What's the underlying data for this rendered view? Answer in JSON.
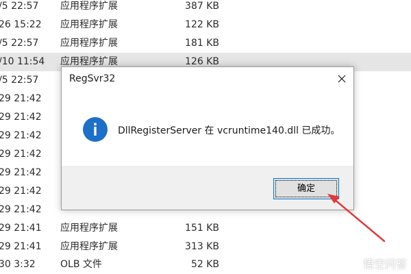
{
  "file_list": {
    "rows": [
      {
        "date": "/5 22:57",
        "type": "应用程序扩展",
        "size": "387 KB",
        "selected": false
      },
      {
        "date": "26 15:22",
        "type": "应用程序扩展",
        "size": "122 KB",
        "selected": false
      },
      {
        "date": "/5 22:57",
        "type": "应用程序扩展",
        "size": "181 KB",
        "selected": false
      },
      {
        "date": "/10 11:54",
        "type": "应用程序扩展",
        "size": "126 KB",
        "selected": true
      },
      {
        "date": "/5 22:57",
        "type": "",
        "size": "",
        "selected": false
      },
      {
        "date": "29 21:42",
        "type": "",
        "size": "",
        "selected": false
      },
      {
        "date": "29 21:42",
        "type": "",
        "size": "",
        "selected": false
      },
      {
        "date": "29 21:42",
        "type": "",
        "size": "",
        "selected": false
      },
      {
        "date": "29 21:42",
        "type": "",
        "size": "",
        "selected": false
      },
      {
        "date": "29 21:42",
        "type": "",
        "size": "",
        "selected": false
      },
      {
        "date": "29 21:42",
        "type": "",
        "size": "",
        "selected": false
      },
      {
        "date": "29 21:42",
        "type": "",
        "size": "",
        "selected": false
      },
      {
        "date": "29 21:41",
        "type": "应用程序扩展",
        "size": "151 KB",
        "selected": false
      },
      {
        "date": "29 21:41",
        "type": "应用程序扩展",
        "size": "313 KB",
        "selected": false
      },
      {
        "date": "30 3:32",
        "type": "OLB 文件",
        "size": "52 KB",
        "selected": false
      }
    ]
  },
  "dialog": {
    "title": "RegSvr32",
    "message": "DllRegisterServer 在 vcruntime140.dll 已成功。",
    "ok_label": "确定",
    "icon": "info-icon",
    "close_icon": "close-icon"
  },
  "annotation": {
    "color": "#e0393b"
  },
  "watermark": {
    "text": "悟空问答"
  }
}
